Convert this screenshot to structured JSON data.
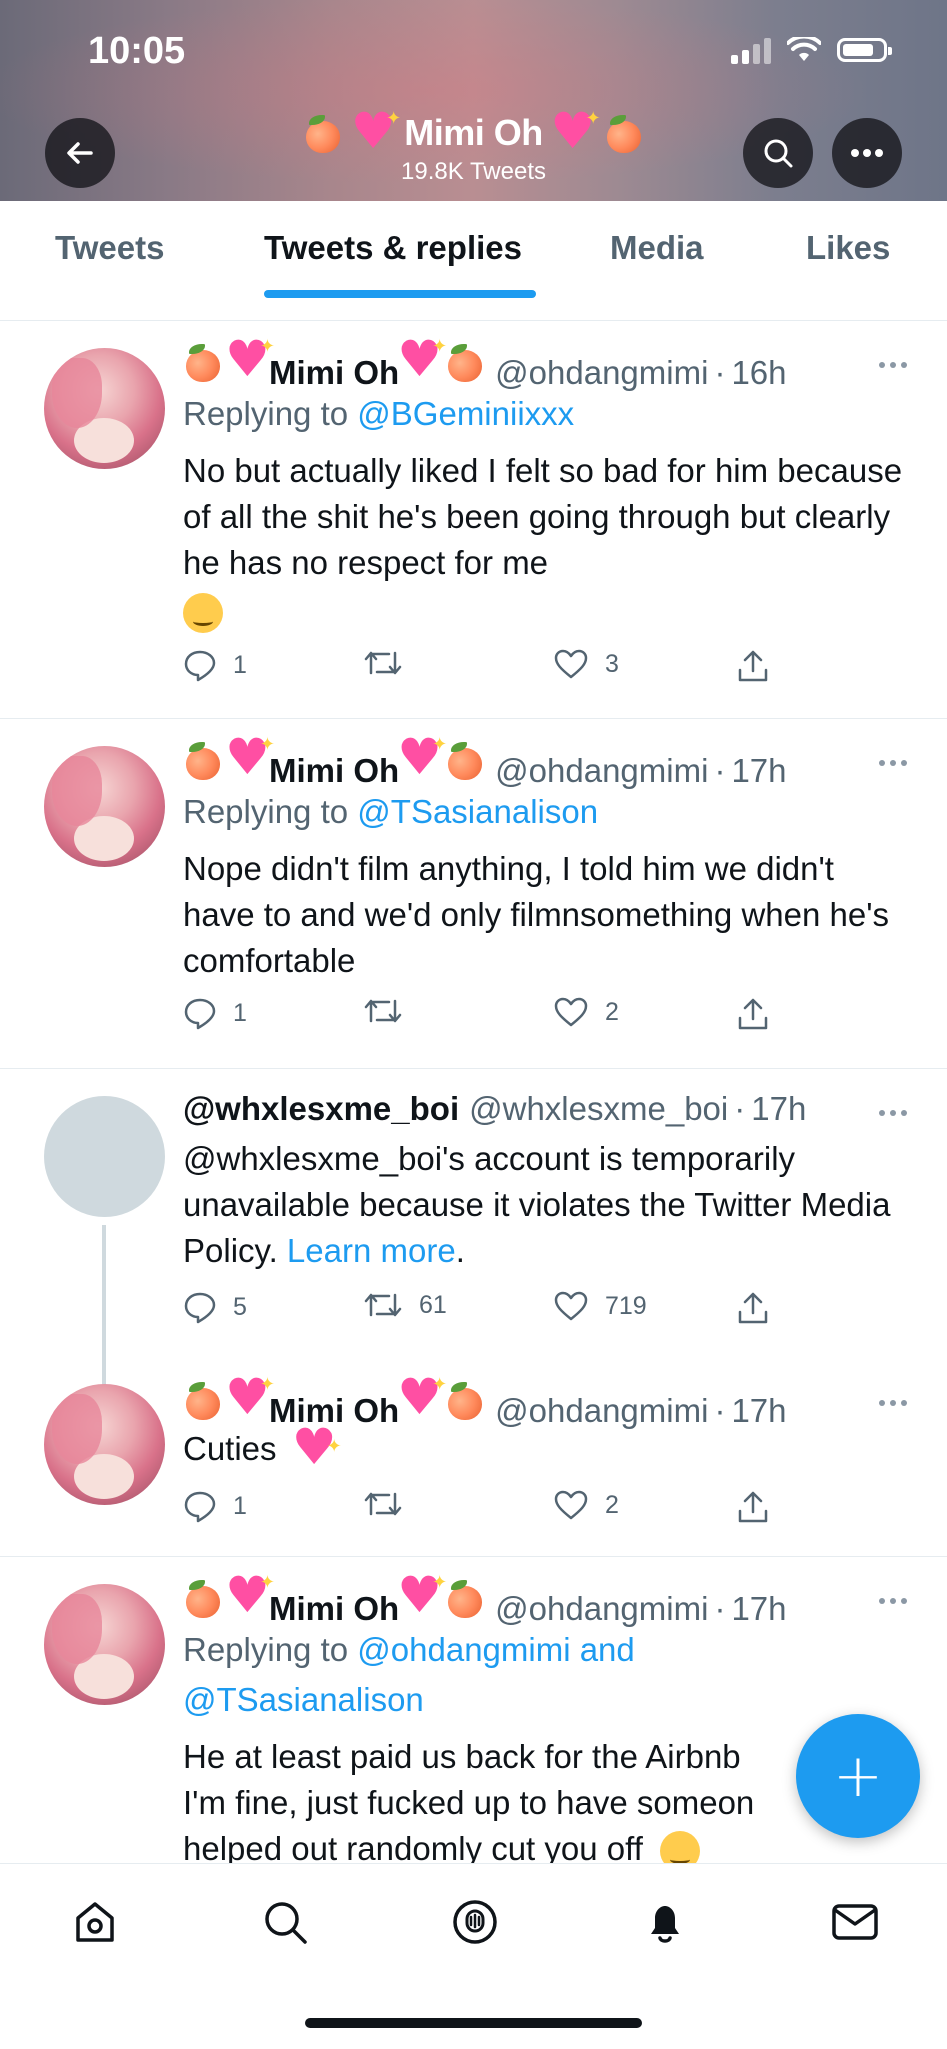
{
  "status": {
    "time": "10:05"
  },
  "header": {
    "name_text": "Mimi Oh",
    "tweet_count": "19.8K Tweets"
  },
  "tabs": [
    {
      "label": "Tweets",
      "active": false
    },
    {
      "label": "Tweets & replies",
      "active": true
    },
    {
      "label": "Media",
      "active": false
    },
    {
      "label": "Likes",
      "active": false
    }
  ],
  "tweets": [
    {
      "name": "Mimi Oh",
      "handle": "@ohdangmimi",
      "time": "16h",
      "replying_prefix": "Replying to",
      "replying_to": "@BGeminiixxx",
      "text": "No but actually liked I felt so bad for him because of all the shit he's been going through but clearly he has no respect for me",
      "replies": "1",
      "retweets": "",
      "likes": "3"
    },
    {
      "name": "Mimi Oh",
      "handle": "@ohdangmimi",
      "time": "17h",
      "replying_prefix": "Replying to",
      "replying_to": "@TSasianalison",
      "text": "Nope didn't film anything, I told him we didn't have to and we'd only filmnsomething when he's comfortable",
      "replies": "1",
      "retweets": "",
      "likes": "2"
    },
    {
      "name": "@whxlesxme_boi",
      "handle": "@whxlesxme_boi",
      "time": "17h",
      "text": "@whxlesxme_boi's account is temporarily unavailable because it violates the Twitter Media Policy.",
      "learn_more": "Learn more",
      "period": ".",
      "replies": "5",
      "retweets": "61",
      "likes": "719"
    },
    {
      "name": "Mimi Oh",
      "handle": "@ohdangmimi",
      "time": "17h",
      "text": "Cuties",
      "replies": "1",
      "retweets": "",
      "likes": "2"
    },
    {
      "name": "Mimi Oh",
      "handle": "@ohdangmimi",
      "time": "17h",
      "replying_prefix": "Replying to",
      "replying_to": "@ohdangmimi and",
      "replying_to_2": "@TSasianalison",
      "text_line1": "He at least paid us back for the Airbnb",
      "text_line2": "I'm fine, just fucked up to have someon",
      "text_line3": "helped out randomly cut you off"
    }
  ],
  "fab": {
    "icon": "compose-plus-icon",
    "label": "+"
  },
  "bottom_nav": [
    "home-icon",
    "search-icon",
    "spaces-icon",
    "notifications-icon",
    "messages-icon"
  ],
  "colors": {
    "accent": "#1d9bf0",
    "text": "#0f1419",
    "secondary": "#536471",
    "divider": "#e6ecf0"
  }
}
